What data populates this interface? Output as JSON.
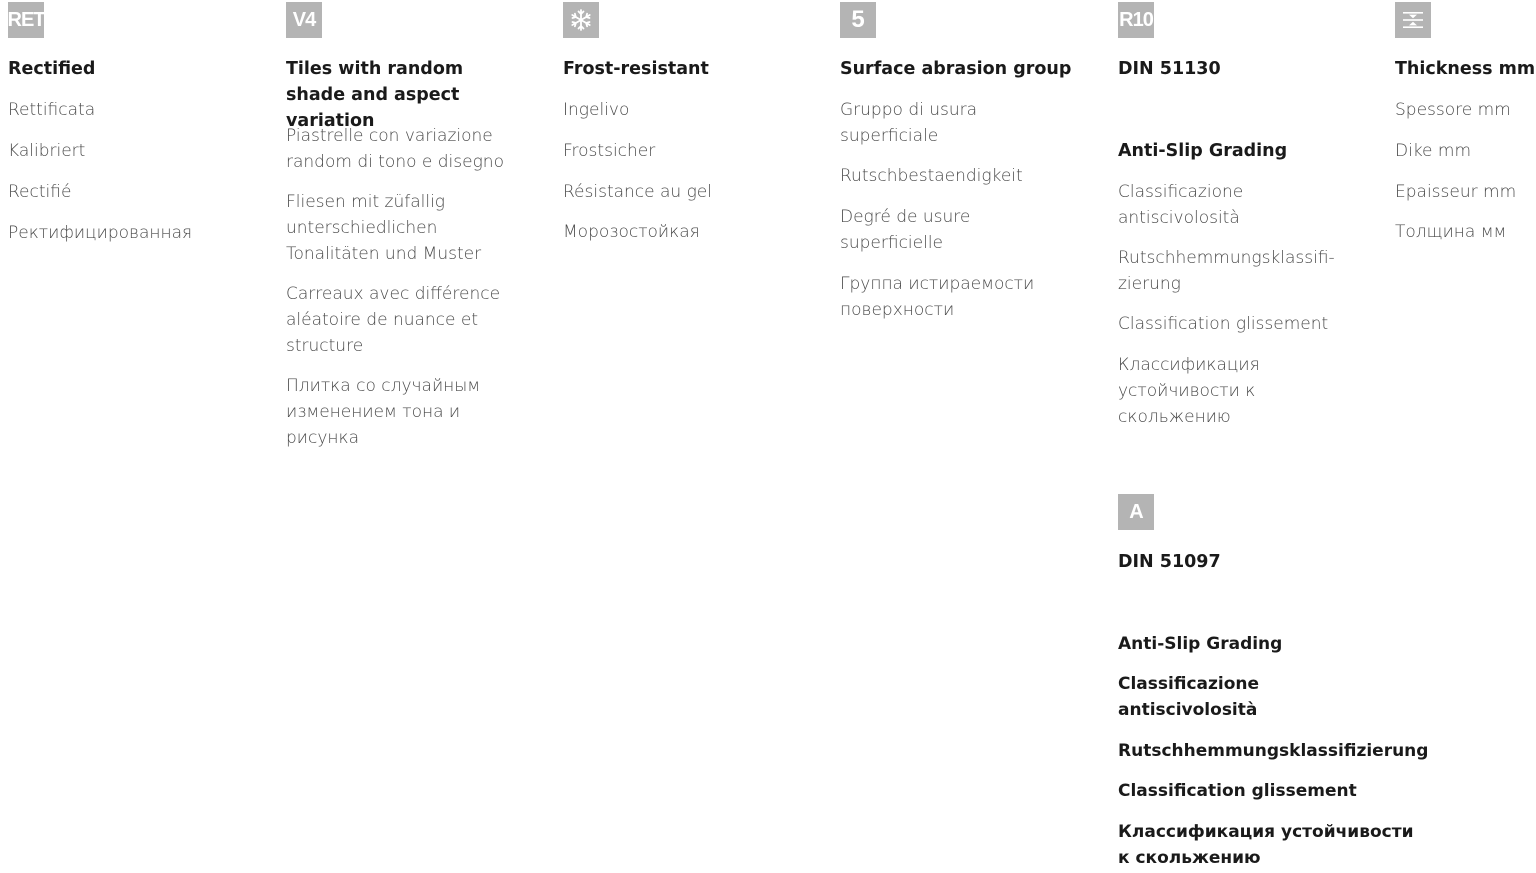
{
  "columns": [
    {
      "badge": "RET",
      "title": "Rectified",
      "items": [
        "Rettificata",
        "Kalibriert",
        "Rectifié",
        "Ректифицированная"
      ]
    },
    {
      "badge": "V4",
      "title": "Tiles with random shade and aspect variation",
      "items": [
        "Piastrelle con variazione random di tono e disegno",
        "Fliesen mit züfallig unterschiedlichen Tonalitäten und Muster",
        "Carreaux avec différence aléatoire de nuance et structure",
        "Плитка со случайным изменением тона и рисунка"
      ]
    },
    {
      "badge_icon": "snowflake-icon",
      "title": "Frost-resistant",
      "items": [
        "Ingelivo",
        "Frostsicher",
        "Résistance au gel",
        "Морозостойкая"
      ]
    },
    {
      "badge": "5",
      "title": "Surface abrasion group",
      "items": [
        "Gruppo di usura superficiale",
        "Rutschbestaendigkeit",
        "Degré de usure superficielle",
        "Группа истираемости поверхности"
      ]
    },
    {
      "badge": "R10",
      "title": "DIN 51130",
      "subtitle": "Anti-Slip Grading",
      "items": [
        "Classificazione antiscivolosità",
        "Rutschhemmungsklassifi- zierung",
        "Classification glissement",
        "Классификация устойчивости к скольжению"
      ],
      "badge2": "A",
      "title2": "DIN 51097",
      "items2": [
        "Anti-Slip Grading",
        "Classificazione antiscivolosità",
        "Rutschhemmungsklassifizierung",
        "Classification glissement",
        "Классификация устойчивости к скольжению"
      ]
    },
    {
      "badge_icon": "thickness-icon",
      "title": "Thickness mm",
      "items": [
        "Spessore mm",
        "Dike mm",
        "Epaisseur mm",
        "Толщина мм"
      ]
    }
  ],
  "colors": {
    "badge_bg": "#b4b4b4",
    "badge_fg": "#ffffff",
    "text": "#4a4a4a",
    "heading": "#1a1a1a"
  }
}
